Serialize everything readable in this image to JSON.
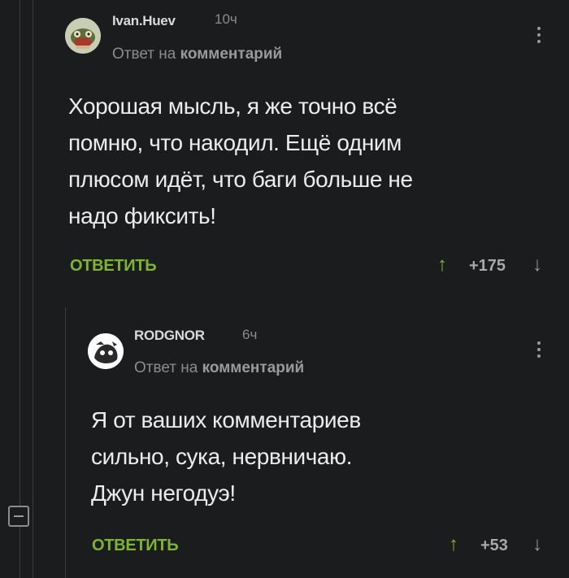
{
  "comments": [
    {
      "author": "Ivan.Huev",
      "time": "10ч",
      "reply_prefix": "Ответ на",
      "reply_target": "комментарий",
      "text": "Хорошая мысль, я же точно всё\nпомню, что накодил. Ещё одним\nплюсом идёт, что баги больше не\nнадо фиксить!",
      "reply_label": "ОТВЕТИТЬ",
      "vote_up": "↑",
      "votes": "+175",
      "vote_down": "↓"
    },
    {
      "author": "RODGNOR",
      "time": "6ч",
      "reply_prefix": "Ответ на",
      "reply_target": "комментарий",
      "text": "Я от ваших комментариев\nсильно, сука, нервничаю.\nДжун негодуэ!",
      "reply_label": "ОТВЕТИТЬ",
      "vote_up": "↑",
      "votes": "+53",
      "vote_down": "↓"
    }
  ],
  "colors": {
    "background": "#1b1c1e",
    "accent_green": "#7fb431",
    "muted_text": "#8c8c8c",
    "thread_line": "#3b3d40"
  }
}
